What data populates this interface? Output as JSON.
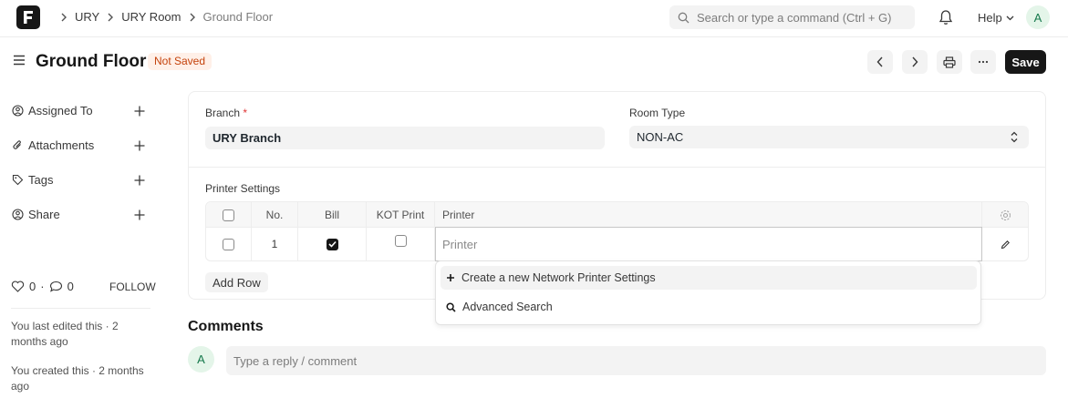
{
  "navbar": {
    "logo_letter": "F",
    "breadcrumbs": [
      "URY",
      "URY Room",
      "Ground Floor"
    ],
    "search_placeholder": "Search or type a command (Ctrl + G)",
    "help_label": "Help",
    "avatar_initial": "A"
  },
  "page": {
    "title": "Ground Floor",
    "status_badge": "Not Saved",
    "save_label": "Save"
  },
  "sidebar": {
    "items": [
      {
        "label": "Assigned To",
        "icon": "user-assign-icon"
      },
      {
        "label": "Attachments",
        "icon": "paperclip-icon"
      },
      {
        "label": "Tags",
        "icon": "tag-icon"
      },
      {
        "label": "Share",
        "icon": "share-icon"
      }
    ],
    "likes_count": "0",
    "comments_count": "0",
    "dot": "·",
    "follow_label": "FOLLOW",
    "last_edited": "You last edited this · 2 months ago",
    "created": "You created this · 2 months ago"
  },
  "form": {
    "branch_label": "Branch",
    "branch_required": "*",
    "branch_value": "URY Branch",
    "room_type_label": "Room Type",
    "room_type_value": "NON-AC",
    "printer_settings_label": "Printer Settings",
    "grid": {
      "columns": [
        "No.",
        "Bill",
        "KOT Print",
        "Printer"
      ],
      "rows": [
        {
          "no": "1",
          "bill": true,
          "kot_print": false,
          "printer": ""
        }
      ],
      "printer_placeholder": "Printer",
      "add_row_label": "Add Row"
    },
    "dropdown": [
      {
        "label": "Create a new Network Printer Settings",
        "icon": "plus-icon"
      },
      {
        "label": "Advanced Search",
        "icon": "search-icon"
      }
    ]
  },
  "comments": {
    "title": "Comments",
    "avatar_initial": "A",
    "placeholder": "Type a reply / comment"
  }
}
